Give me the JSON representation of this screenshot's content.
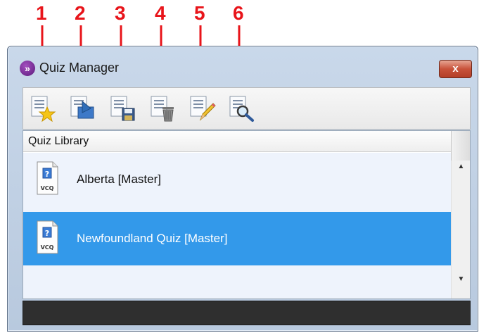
{
  "callouts": [
    "1",
    "2",
    "3",
    "4",
    "5",
    "6"
  ],
  "window": {
    "title": "Quiz Manager",
    "close_glyph": "x"
  },
  "toolbar": {
    "buttons": [
      {
        "icon": "new-quiz-star-icon"
      },
      {
        "icon": "import-quiz-icon"
      },
      {
        "icon": "save-quiz-icon"
      },
      {
        "icon": "delete-quiz-icon"
      },
      {
        "icon": "edit-quiz-icon"
      },
      {
        "icon": "preview-quiz-icon"
      }
    ]
  },
  "library": {
    "header": "Quiz Library",
    "items": [
      {
        "name": "Alberta [Master]",
        "file_badge": "VCQ",
        "selected": false
      },
      {
        "name": "Newfoundland Quiz [Master]",
        "file_badge": "VCQ",
        "selected": true
      }
    ]
  },
  "colors": {
    "callout": "#e8141a",
    "selection": "#3399ea",
    "status_bar": "#2f2f2f"
  }
}
